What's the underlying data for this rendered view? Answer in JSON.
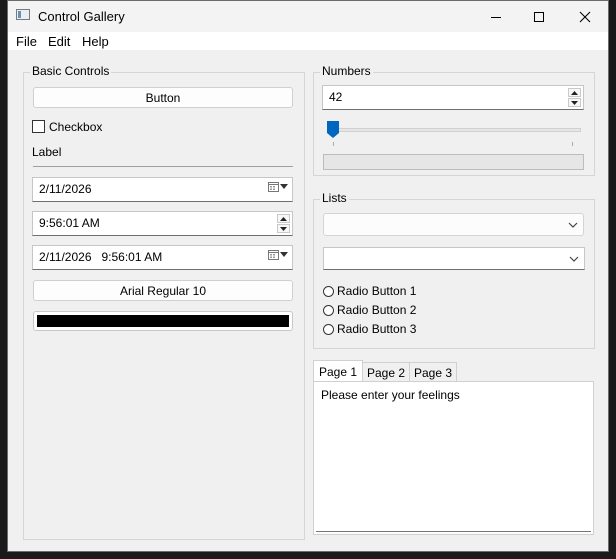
{
  "window": {
    "title": "Control Gallery"
  },
  "menu": [
    "File",
    "Edit",
    "Help"
  ],
  "basic": {
    "title": "Basic Controls",
    "button": "Button",
    "checkbox": "Checkbox",
    "label": "Label",
    "date": "2/11/2026",
    "time": "9:56:01 AM",
    "datetime": "2/11/2026   9:56:01 AM",
    "font_button": "Arial Regular 10",
    "color": "#000000"
  },
  "numbers": {
    "title": "Numbers",
    "spin_value": "42",
    "slider_value": 0,
    "progress_value": 0
  },
  "lists": {
    "title": "Lists",
    "combo1": "",
    "combo2": "",
    "radios": [
      "Radio Button 1",
      "Radio Button 2",
      "Radio Button 3"
    ]
  },
  "tabs": {
    "labels": [
      "Page 1",
      "Page 2",
      "Page 3"
    ],
    "active": 0,
    "content": "Please enter your feelings"
  }
}
